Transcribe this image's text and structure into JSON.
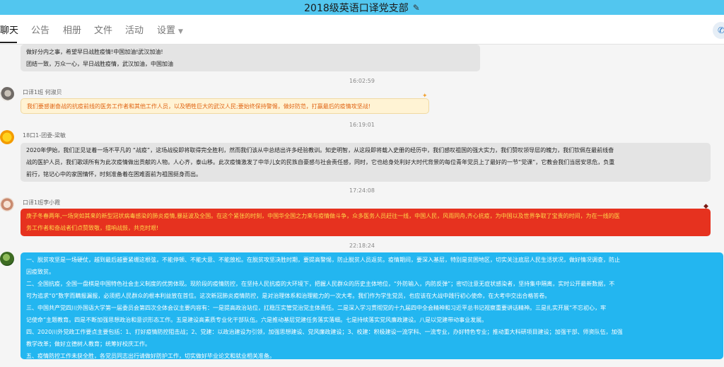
{
  "header": {
    "title": "2018级英语口译党支部",
    "edit_icon": "edit-icon"
  },
  "tabs": [
    {
      "label": "聊天",
      "active": true
    },
    {
      "label": "公告",
      "active": false
    },
    {
      "label": "相册",
      "active": false
    },
    {
      "label": "文件",
      "active": false
    },
    {
      "label": "活动",
      "active": false
    },
    {
      "label": "设置",
      "active": false
    }
  ],
  "call_icon": "phone-icon",
  "messages": [
    {
      "lines": [
        "做好分内之事，希望早日战胜疫情!中国加油!武汉加油!",
        "团结一致，万众一心，早日战胜疫情，武汉加油，中国加油"
      ]
    },
    {
      "time": "16:02:59",
      "sender": "口译1班 何淑贝",
      "lines": [
        "我们要感谢奋战的抗疫前线的医务工作者和其他工作人员，以及牺牲巨大的武汉人民;要始终保持警惕，做好防范，打赢最后的疫情攻坚战!"
      ]
    },
    {
      "time": "16:19:01",
      "sender": "18口1-团委-梁敏",
      "lines": [
        "2020年伊始，我们正见证着一场不平凡的 “战疫”，这场战役即将取得完全胜利，然而我们该从中总结出许多经验教训。知史明智，从这段即将载入史册的经历中，我们感叹祖国的强大实力，我们赞叹领导层的魄力，我们钦佩在最前线奋",
        "战的医护人员，我们歌颂所有为此次疫情做出贡献的人物。人心齐，泰山移。此次疫情激发了中华儿女的民族自豪感与社会责任感，同时，它也给身处利好大时代背景的每位青年党员上了最好的一节“党课”，它教会我们当居安思危，负重",
        "前行，铭记心中的家国情怀，时刻准备着在困难面前为祖国挺身而出。"
      ]
    },
    {
      "time": "17:24:08",
      "sender": "口译1班李小霞",
      "lines": [
        "庚子冬春两年,一场突如其来的新型冠状病毒感染的肺炎疫情,暴延波及全国。在这个紧张的时刻，中国华全国之力来与疫情做斗争，众多医务人员赶往一线，中国人民，风雨同舟,齐心抗疫，为中国以及世界争取了宝贵的时间，为在一线的医",
        "务工作者和奋战者们点赞致敬，擂响战鼓，共克时艰!"
      ]
    },
    {
      "time": "22:18:24",
      "sender": "",
      "lines": [
        "一、脱贫攻坚是一场硬仗，越到最后越要紧绷这根弦，不能停顿、不能大意、不能放松。在脱贫攻坚决胜时期，要提高警惕，防止脱贫人员返贫。疫情期间，要深入基层，特别是贫困地区，切实关注底层人民生活状况，做好情况调查，防止",
        "因疫致贫。",
        "二、全国抗疫，全国一盘棋是中国特色社会主义制度的优势体现。现阶段的疫情防控，在坚持人民抗疫的大环境下，把握人民群众的历史主体地位，“外防输入，内防反弹”；密切注意无症状感染者，坚持集中隔离，实时公开最新数据，不",
        "可为追求“0”数字而瞒报漏报，必须把人民群众的根本利益放在首位。这次新冠肺炎疫情防控，是对治理体系和治理能力的一次大考。我们作为学生党员，也应该在大战中践行初心使命，在大考中交出合格答卷。",
        "三、中国共产党四川外国语大学第一届委员会第四次全体会议主要内容有：一是提高政治站位，扛稳压实管党治党主体责任。二是深入学习贯彻党的十九届四中全会精神和习近平总书记视察重要讲话精神。三是扎实开展“不忘初心，牢",
        "记使命”主题教育。四是不断加强思想政治和意识形态工作。五是建设高素质专业化干部队伍。六是推动基层党建任务落实落细。七是持续落实党风廉政建设。八是以党建带动事业发展。",
        "四、2020川外党政工作要点主要包括：1、打好疫情防控阻击战；2、党建：以政治建设为引领，加强思想建设、党风廉政建设；3、校建：积极建设一流学科、一流专业，办好特色专业；推动重大科研项目建设；加强干部、师资队伍，加强",
        "教学改革；做好立德树人教育；统筹好校庆工作。",
        " 五、疫情防控工作未获全胜，各党员同志出行请做好防护工作，切实做好毕业论文和就业相关准备。"
      ]
    }
  ]
}
